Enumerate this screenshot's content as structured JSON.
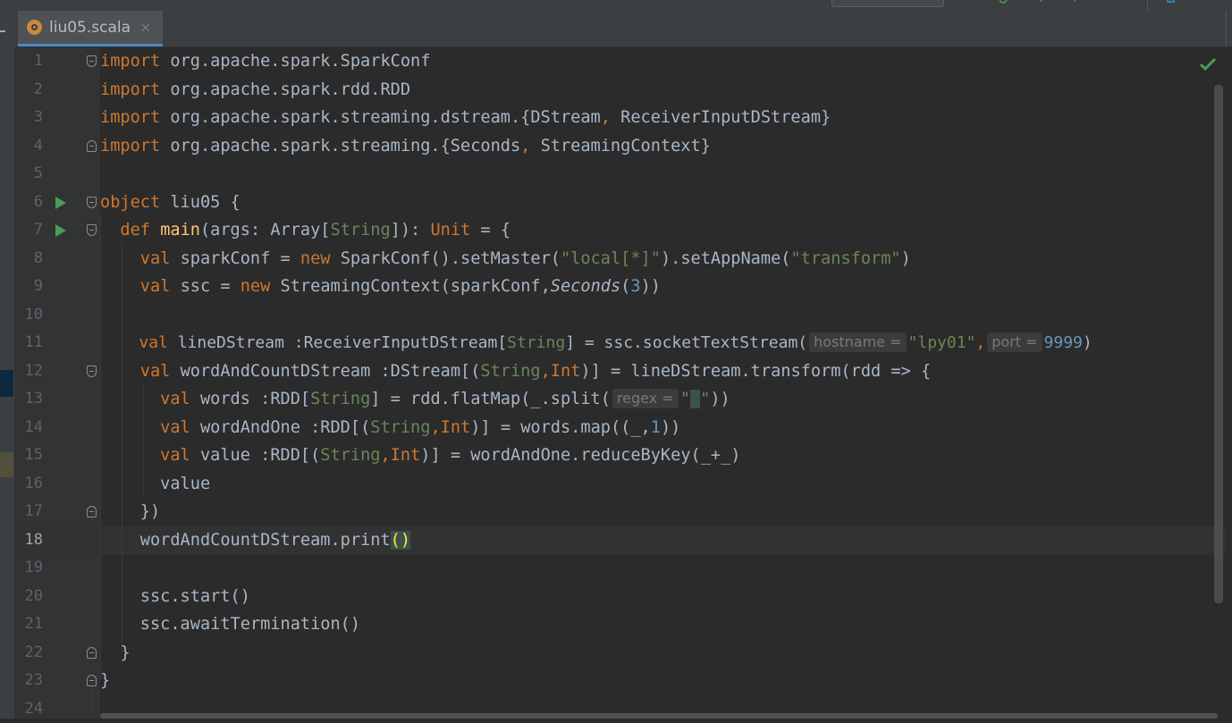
{
  "tab": {
    "filename": "liu05.scala",
    "close": "×"
  },
  "status": {
    "inspection": "check-icon"
  },
  "lines": [
    {
      "n": "1"
    },
    {
      "n": "2"
    },
    {
      "n": "3"
    },
    {
      "n": "4"
    },
    {
      "n": "5"
    },
    {
      "n": "6"
    },
    {
      "n": "7"
    },
    {
      "n": "8"
    },
    {
      "n": "9"
    },
    {
      "n": "10"
    },
    {
      "n": "11"
    },
    {
      "n": "12"
    },
    {
      "n": "13"
    },
    {
      "n": "14"
    },
    {
      "n": "15"
    },
    {
      "n": "16"
    },
    {
      "n": "17"
    },
    {
      "n": "18"
    },
    {
      "n": "19"
    },
    {
      "n": "20"
    },
    {
      "n": "21"
    },
    {
      "n": "22"
    },
    {
      "n": "23"
    },
    {
      "n": "24"
    }
  ],
  "code": {
    "l1": {
      "kw": "import",
      "rest": " org.apache.spark.SparkConf"
    },
    "l2": {
      "kw": "import",
      "rest": " org.apache.spark.rdd.RDD"
    },
    "l3": {
      "kw": "import",
      "a": " org.apache.spark.streaming.dstream.{DStream",
      "comma": ",",
      "b": " ReceiverInputDStream}"
    },
    "l4": {
      "kw": "import",
      "a": " org.apache.spark.streaming.{Seconds",
      "comma": ",",
      "b": " StreamingContext}"
    },
    "l6": {
      "kw": "object",
      "rest": " liu05 {"
    },
    "l7": {
      "indent": "  ",
      "kw": "def",
      "sp": " ",
      "fn": "main",
      "a": "(args: Array[",
      "type": "String",
      "b": "]): ",
      "unit": "Unit",
      "c": " = {"
    },
    "l8": {
      "indent": "    ",
      "kw": "val",
      "a": " sparkConf = ",
      "new": "new",
      "b": " SparkConf().setMaster(",
      "s1": "\"local[*]\"",
      "c": ").setAppName(",
      "s2": "\"transform\"",
      "d": ")"
    },
    "l9": {
      "indent": "    ",
      "kw": "val",
      "a": " ssc = ",
      "new": "new",
      "b": " StreamingContext(sparkConf,",
      "it": "Seconds",
      "c": "(",
      "num": "3",
      "d": "))"
    },
    "l11": {
      "indent": "    ",
      "kw": "val",
      "a": " lineDStream :ReceiverInputDStream[",
      "type": "String",
      "b": "] = ssc.socketTextStream(",
      "hint1": "hostname =",
      "s1": "\"lpy01\"",
      "comma": ",",
      "hint2": "port =",
      "num": "9999",
      "c": ")"
    },
    "l12": {
      "indent": "    ",
      "kw": "val",
      "a": " wordAndCountDStream :DStream[(",
      "t1": "String",
      "comma": ",",
      "t2": "Int",
      "b": ")] = lineDStream.transform(rdd => {"
    },
    "l13": {
      "indent": "      ",
      "kw": "val",
      "a": " words :RDD[",
      "type": "String",
      "b": "] = rdd.flatMap(_.split(",
      "hint": "regex =",
      "q1": "\"",
      "space": " ",
      "q2": "\"",
      "c": "))"
    },
    "l14": {
      "indent": "      ",
      "kw": "val",
      "a": " wordAndOne :RDD[(",
      "t1": "String",
      "comma": ",",
      "t2": "Int",
      "b": ")] = words.map((_,",
      "num": "1",
      "c": "))"
    },
    "l15": {
      "indent": "      ",
      "kw": "val",
      "a": " value :RDD[(",
      "t1": "String",
      "comma": ",",
      "t2": "Int",
      "b": ")] = wordAndOne.reduceByKey(_+_)"
    },
    "l16": {
      "text": "      value"
    },
    "l17": {
      "text": "    })"
    },
    "l18": {
      "indent": "    ",
      "a": "wordAndCountDStream.print",
      "paren": "()"
    },
    "l20": {
      "text": "    ssc.start()"
    },
    "l21": {
      "text": "    ssc.awaitTermination()"
    },
    "l22": {
      "text": "  }"
    },
    "l23": {
      "text": "}"
    }
  },
  "colors": {
    "keyword": "#cc7832",
    "function": "#ffc66d",
    "string": "#6a8759",
    "number": "#6897bb",
    "text": "#a9b7c6",
    "background": "#2b2b2b",
    "gutter": "#313335"
  }
}
